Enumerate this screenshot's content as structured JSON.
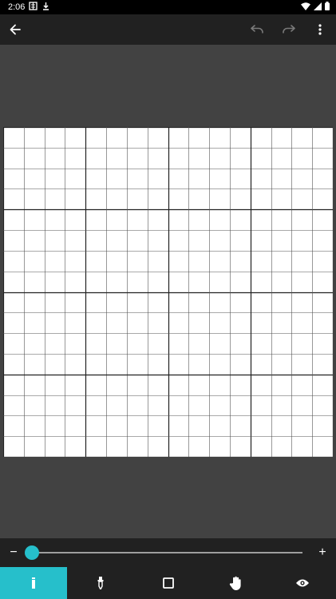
{
  "status_bar": {
    "time": "2:06",
    "left_icons": [
      "notification-app-icon",
      "download-icon"
    ],
    "right_icons": [
      "wifi-icon",
      "cellular-signal-icon",
      "battery-icon"
    ]
  },
  "toolbar": {
    "back_icon": "arrow-back-icon",
    "undo_icon": "undo-icon",
    "redo_icon": "redo-icon",
    "more_icon": "more-vert-icon"
  },
  "grid": {
    "cells": 16,
    "major_every": 4
  },
  "zoom": {
    "minus_label": "−",
    "plus_label": "+",
    "level": 0
  },
  "bottom_nav": [
    {
      "icon": "pencil-tool-icon",
      "active": true
    },
    {
      "icon": "dropper-tool-icon",
      "active": false
    },
    {
      "icon": "square-tool-icon",
      "active": false
    },
    {
      "icon": "hand-pan-icon",
      "active": false
    },
    {
      "icon": "eye-preview-icon",
      "active": false
    }
  ],
  "colors": {
    "accent": "#26bfcb",
    "toolbar_bg": "#212121",
    "canvas_bg": "#424242",
    "grid_bg": "#ffffff"
  }
}
